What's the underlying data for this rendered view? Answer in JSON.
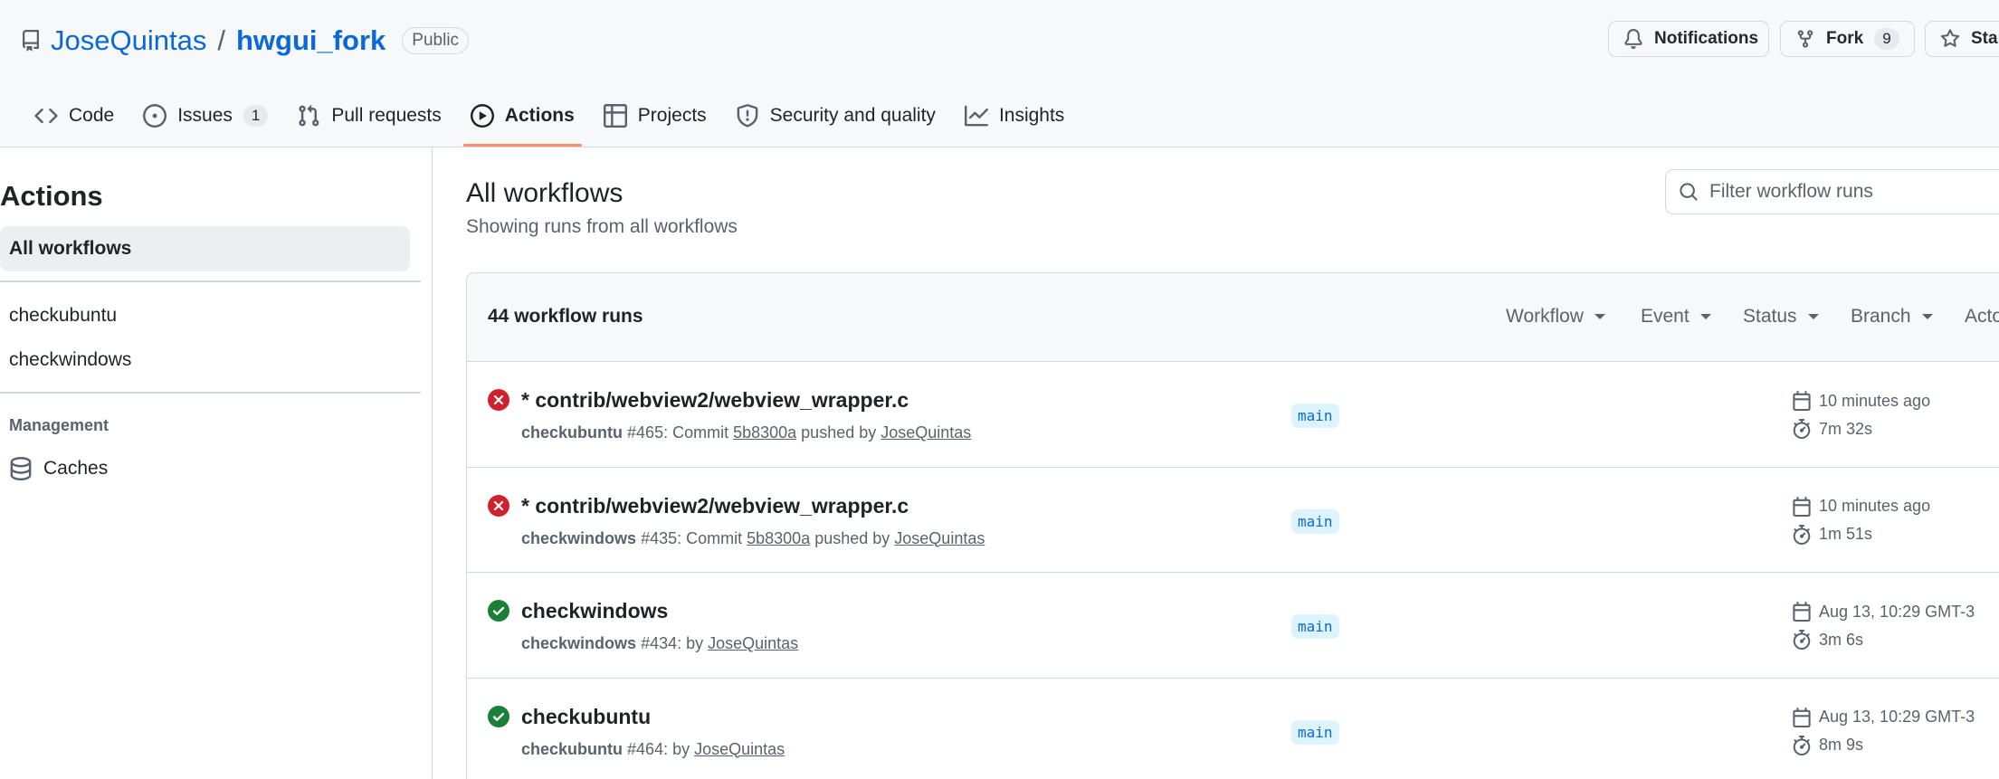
{
  "repo": {
    "owner": "JoseQuintas",
    "separator": "/",
    "name": "hwgui_fork",
    "visibility": "Public"
  },
  "header_buttons": {
    "notifications": "Notifications",
    "fork": "Fork",
    "fork_count": "9",
    "star": "Star"
  },
  "tabs": [
    {
      "label": "Code",
      "icon": "code-icon"
    },
    {
      "label": "Issues",
      "icon": "issue-icon",
      "count": "1"
    },
    {
      "label": "Pull requests",
      "icon": "pull-request-icon"
    },
    {
      "label": "Actions",
      "icon": "play-icon",
      "selected": true
    },
    {
      "label": "Projects",
      "icon": "table-icon"
    },
    {
      "label": "Security and quality",
      "icon": "shield-icon"
    },
    {
      "label": "Insights",
      "icon": "graph-icon"
    }
  ],
  "sidebar": {
    "title": "Actions",
    "items": [
      {
        "label": "All workflows",
        "active": true
      },
      {
        "label": "checkubuntu"
      },
      {
        "label": "checkwindows"
      }
    ],
    "management_heading": "Management",
    "caches_label": "Caches"
  },
  "main": {
    "title": "All workflows",
    "subtitle": "Showing runs from all workflows",
    "filter_placeholder": "Filter workflow runs",
    "run_count": "44 workflow runs",
    "filters": [
      "Workflow",
      "Event",
      "Status",
      "Branch",
      "Actor"
    ]
  },
  "runs": [
    {
      "status": "failure",
      "title": "* contrib/webview2/webview_wrapper.c",
      "workflow": "checkubuntu",
      "number": "#465",
      "meta_mid": ": Commit ",
      "commit": "5b8300a",
      "meta_tail": " pushed by ",
      "user": "JoseQuintas",
      "branch": "main",
      "when": "10 minutes ago",
      "duration": "7m 32s"
    },
    {
      "status": "failure",
      "title": "* contrib/webview2/webview_wrapper.c",
      "workflow": "checkwindows",
      "number": "#435",
      "meta_mid": ": Commit ",
      "commit": "5b8300a",
      "meta_tail": " pushed by ",
      "user": "JoseQuintas",
      "branch": "main",
      "when": "10 minutes ago",
      "duration": "1m 51s"
    },
    {
      "status": "success",
      "title": "checkwindows",
      "workflow": "checkwindows",
      "number": "#434",
      "meta_mid": ": by ",
      "commit": "",
      "meta_tail": "",
      "user": "JoseQuintas",
      "branch": "main",
      "when": "Aug 13, 10:29 GMT-3",
      "duration": "3m 6s"
    },
    {
      "status": "success",
      "title": "checkubuntu",
      "workflow": "checkubuntu",
      "number": "#464",
      "meta_mid": ": by ",
      "commit": "",
      "meta_tail": "",
      "user": "JoseQuintas",
      "branch": "main",
      "when": "Aug 13, 10:29 GMT-3",
      "duration": "8m 9s"
    }
  ],
  "colors": {
    "accent": "#0969da",
    "failure": "#cf222e",
    "success": "#1a7f37",
    "selected_tab": "#fd8c73",
    "branch_bg": "#ddf4ff"
  }
}
